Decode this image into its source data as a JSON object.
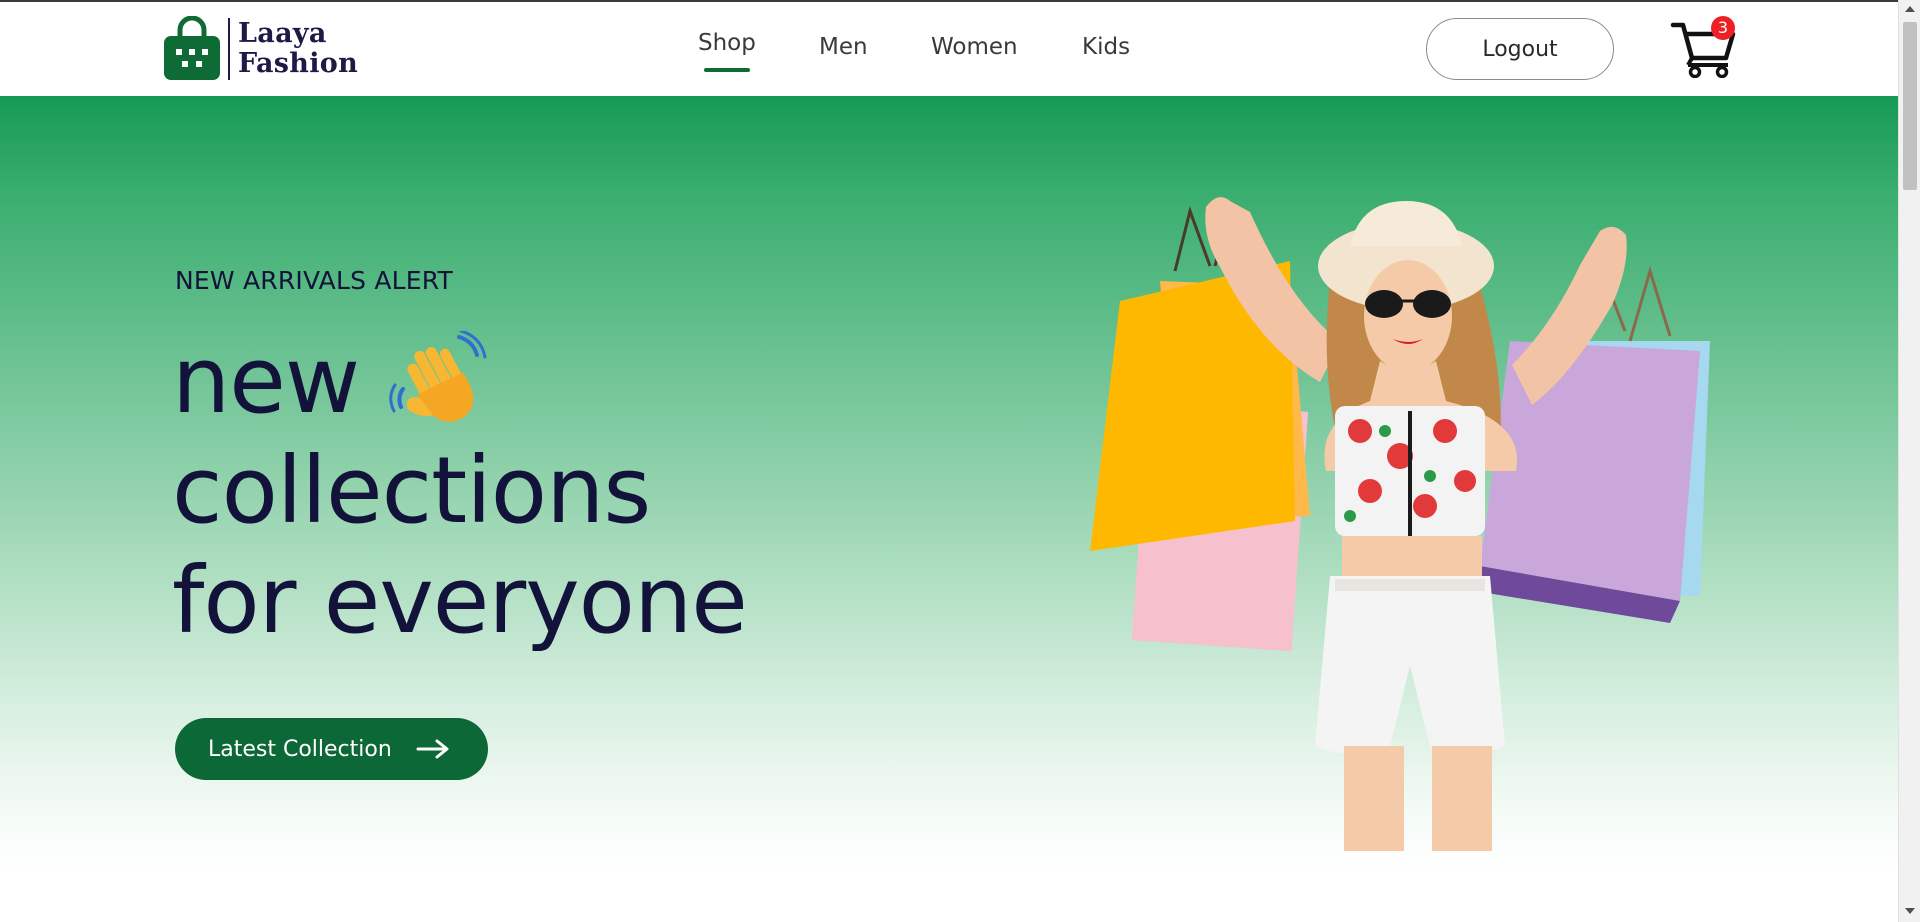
{
  "brand": {
    "line1": "Laaya",
    "line2": "Fashion",
    "color": "#0e6b35",
    "text_color": "#1d1b45"
  },
  "nav": {
    "items": [
      {
        "label": "Shop",
        "active": true
      },
      {
        "label": "Men",
        "active": false
      },
      {
        "label": "Women",
        "active": false
      },
      {
        "label": "Kids",
        "active": false
      }
    ]
  },
  "header": {
    "logout_label": "Logout",
    "cart_icon": "shopping-cart-icon",
    "cart_count": "3",
    "badge_color": "#ee1f25"
  },
  "hero": {
    "eyebrow": "NEW ARRIVALS ALERT",
    "headline_line1": "new",
    "headline_line2": "collections",
    "headline_line3": "for everyone",
    "wave_icon": "waving-hand-icon",
    "cta_label": "Latest Collection",
    "cta_icon": "arrow-right-icon",
    "gradient_top": "#169956",
    "gradient_bottom": "#ffffff",
    "button_color": "#0c6836"
  }
}
